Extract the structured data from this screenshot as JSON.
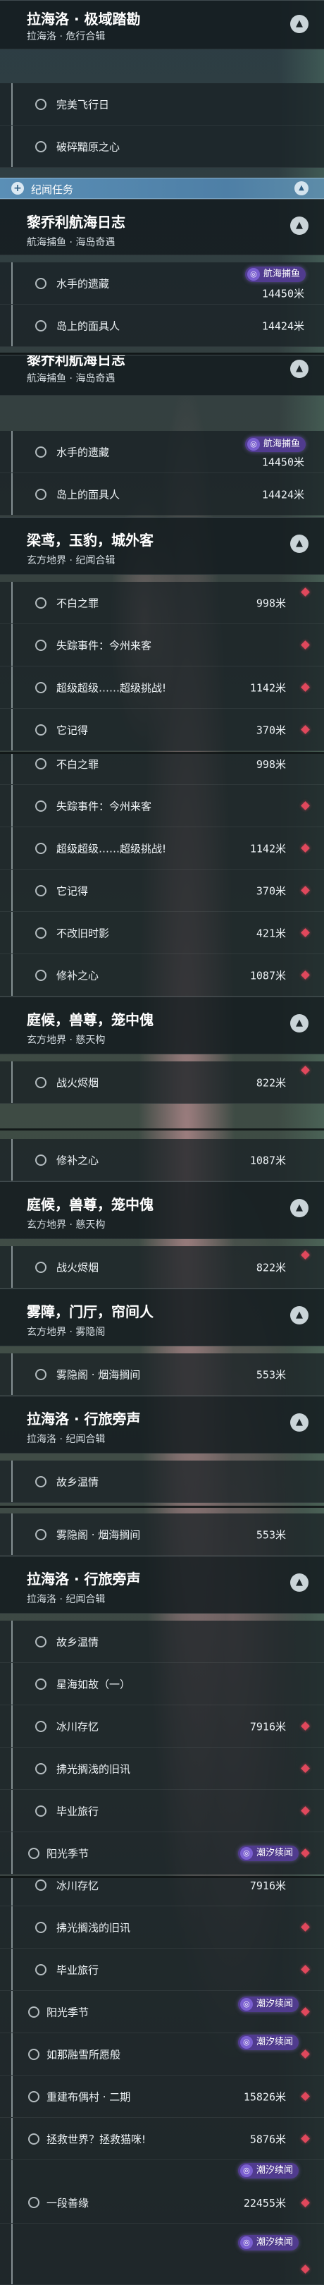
{
  "section": {
    "label": "纪闻任务"
  },
  "groups": {
    "g1": {
      "title": "拉海洛 · 极域踏勘",
      "subtitle": "拉海洛 · 危行合辑"
    },
    "g2": {
      "title": "黎乔利航海日志",
      "subtitle": "航海捕鱼 · 海岛奇遇"
    },
    "g3": {
      "title": "黎乔利航海日志",
      "subtitle": "航海捕鱼 · 海岛奇遇"
    },
    "g4": {
      "title": "梁鸢，玉豹，城外客",
      "subtitle": "玄方地界 · 纪闻合辑"
    },
    "g5": {
      "title": "庭候，兽尊，笼中傀",
      "subtitle": "玄方地界 · 慈天构"
    },
    "g6": {
      "title": "庭候，兽尊，笼中傀",
      "subtitle": "玄方地界 · 慈天构"
    },
    "g7": {
      "title": "雾障，门厅，帘间人",
      "subtitle": "玄方地界 · 雾隐阁"
    },
    "g8": {
      "title": "拉海洛 · 行旅旁声",
      "subtitle": "拉海洛 · 纪闻合辑"
    },
    "g9": {
      "title": "拉海洛 · 行旅旁声",
      "subtitle": "拉海洛 · 纪闻合辑"
    }
  },
  "quests": {
    "q1": {
      "name": "完美飞行日"
    },
    "q2": {
      "name": "破碎黯原之心"
    },
    "q3": {
      "name": "水手的遗藏",
      "distance": "14450米",
      "badge": "航海捕鱼"
    },
    "q4": {
      "name": "岛上的面具人",
      "distance": "14424米"
    },
    "q5": {
      "name": "水手的遗藏",
      "distance": "14450米",
      "badge": "航海捕鱼"
    },
    "q6": {
      "name": "岛上的面具人",
      "distance": "14424米"
    },
    "q7": {
      "name": "不白之罪",
      "distance": "998米"
    },
    "q8": {
      "name": "失踪事件：今州来客"
    },
    "q9": {
      "name": "超级超级……超级挑战!",
      "distance": "1142米"
    },
    "q10": {
      "name": "它记得",
      "distance": "370米"
    },
    "q11": {
      "name": "不白之罪",
      "distance": "998米"
    },
    "q12": {
      "name": "失踪事件：今州来客"
    },
    "q13": {
      "name": "超级超级……超级挑战!",
      "distance": "1142米"
    },
    "q14": {
      "name": "它记得",
      "distance": "370米"
    },
    "q15": {
      "name": "不改旧时影",
      "distance": "421米"
    },
    "q16": {
      "name": "修补之心",
      "distance": "1087米"
    },
    "q17": {
      "name": "战火烬烟",
      "distance": "822米"
    },
    "q18": {
      "name": "修补之心",
      "distance": "1087米"
    },
    "q19": {
      "name": "战火烬烟",
      "distance": "822米"
    },
    "q20": {
      "name": "雾隐阁 · 烟海搁间",
      "distance": "553米"
    },
    "q21": {
      "name": "故乡温情"
    },
    "q22": {
      "name": "雾隐阁 · 烟海搁间",
      "distance": "553米"
    },
    "q23": {
      "name": "故乡温情"
    },
    "q24": {
      "name": "星海如故（一）"
    },
    "q25": {
      "name": "冰川存忆",
      "distance": "7916米"
    },
    "q26": {
      "name": "拂光搁浅的旧讯"
    },
    "q27": {
      "name": "毕业旅行"
    },
    "q28": {
      "name": "阳光季节",
      "badge": "潮汐续闻"
    },
    "q29": {
      "name": "冰川存忆",
      "distance": "7916米"
    },
    "q30": {
      "name": "拂光搁浅的旧讯"
    },
    "q31": {
      "name": "毕业旅行"
    },
    "q32": {
      "name": "阳光季节",
      "badge": "潮汐续闻"
    },
    "q33": {
      "name": "如那融雪所愿般",
      "badge": "潮汐续闻"
    },
    "q34": {
      "name": "重建布偶村 · 二期",
      "distance": "15826米"
    },
    "q35": {
      "name": "拯救世界？拯救猫咪!",
      "distance": "5876米"
    },
    "q36": {
      "name": "一段善缘",
      "distance": "22455米",
      "badge": "潮汐续闻"
    },
    "q37": {
      "badge": "潮汐续闻"
    }
  },
  "icons": {
    "collapse": "chevron-up-icon",
    "quest_status": "circle-icon",
    "tracked": "red-diamond-icon",
    "section": "plus-icon",
    "badge": "tide-icon"
  },
  "colors": {
    "section_bar": "#5a8fb6",
    "tracked_marker": "#e0485c",
    "badge_bg": "#503b8e"
  }
}
